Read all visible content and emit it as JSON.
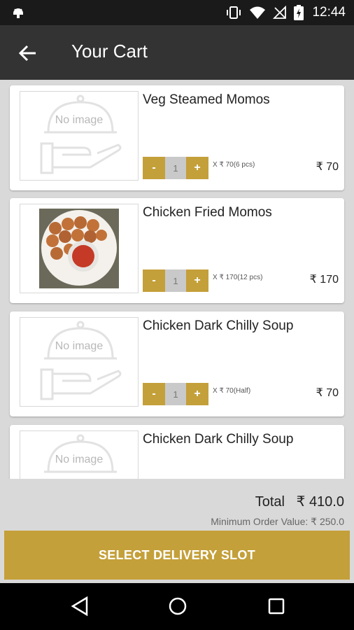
{
  "status_bar": {
    "time": "12:44"
  },
  "header": {
    "title": "Your Cart"
  },
  "cart": {
    "items": [
      {
        "name": "Veg Steamed Momos",
        "image_text": "No image",
        "qty": "1",
        "minus": "-",
        "plus": "+",
        "unit_price": "X ₹ 70(6 pcs)",
        "price": "₹ 70"
      },
      {
        "name": "Chicken Fried Momos",
        "image_text": "",
        "qty": "1",
        "minus": "-",
        "plus": "+",
        "unit_price": "X ₹ 170(12 pcs)",
        "price": "₹ 170"
      },
      {
        "name": "Chicken Dark Chilly Soup",
        "image_text": "No image",
        "qty": "1",
        "minus": "-",
        "plus": "+",
        "unit_price": "X ₹ 70(Half)",
        "price": "₹ 70"
      },
      {
        "name": "Chicken Dark Chilly Soup",
        "image_text": "No image",
        "qty": "",
        "minus": "",
        "plus": "",
        "unit_price": "",
        "price": ""
      }
    ]
  },
  "summary": {
    "total_label": "Total",
    "total_value": "₹ 410.0",
    "min_order_text": "Minimum Order Value: ₹ 250.0"
  },
  "cta": {
    "label": "SELECT DELIVERY SLOT"
  },
  "colors": {
    "accent": "#c4a03a",
    "appbar": "#333333",
    "background": "#d9d9d9"
  }
}
